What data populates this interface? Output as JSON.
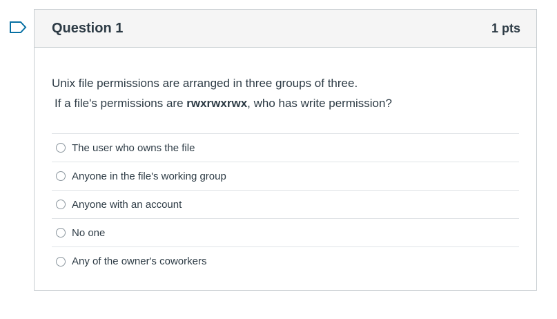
{
  "question": {
    "title": "Question 1",
    "points": "1 pts",
    "prompt_line1": "Unix file permissions are arranged in three groups of three.",
    "prompt_line2_before": "If a file's permissions are ",
    "prompt_line2_bold": "rwxrwxrwx",
    "prompt_line2_after": ", who has write permission?"
  },
  "answers": [
    {
      "label": "The user who owns the file"
    },
    {
      "label": "Anyone in the file's working group"
    },
    {
      "label": "Anyone with an account"
    },
    {
      "label": "No one"
    },
    {
      "label": "Any of the owner's coworkers"
    }
  ],
  "colors": {
    "flag": "#0770a3",
    "text": "#2d3b45",
    "border": "#c7cdd1",
    "header_bg": "#f5f5f5"
  },
  "icons": {
    "flag": "flag-bookmark-icon"
  }
}
